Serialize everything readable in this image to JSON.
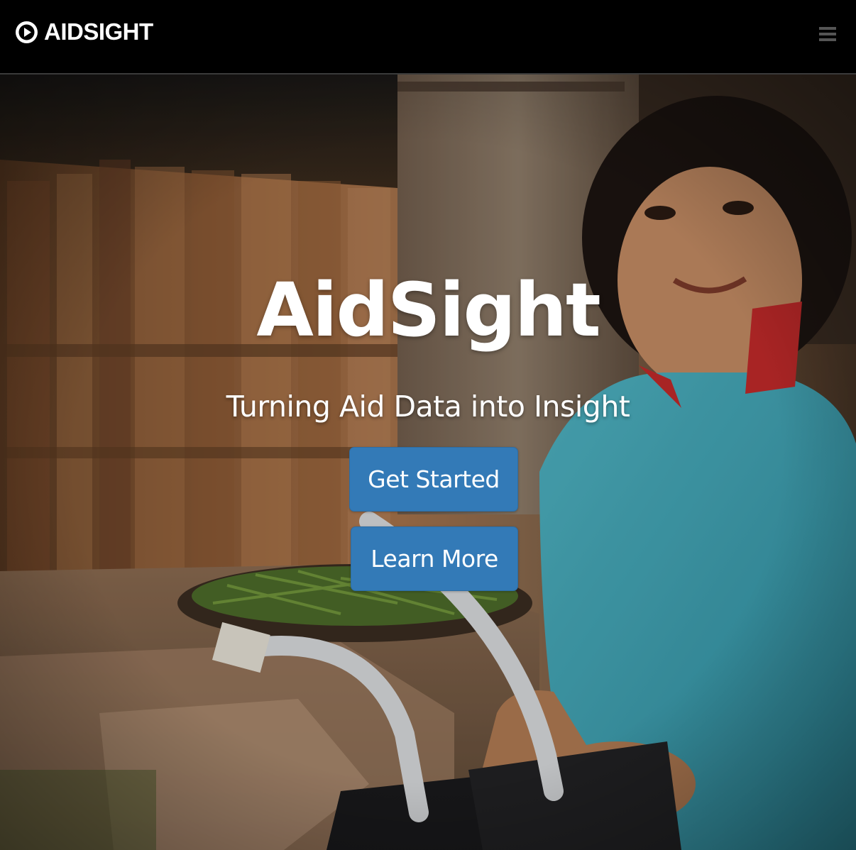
{
  "navbar": {
    "brand_icon": "play-circle-icon",
    "brand_text": "AIDSIGHT",
    "menu_icon": "hamburger-menu-icon",
    "menu_icon_color": "#555555",
    "background": "#000000"
  },
  "hero": {
    "title": "AidSight",
    "subtitle": "Turning Aid Data into Insight",
    "buttons": [
      {
        "label": "Get Started"
      },
      {
        "label": "Learn More"
      }
    ],
    "button_color": "#337ab7"
  }
}
